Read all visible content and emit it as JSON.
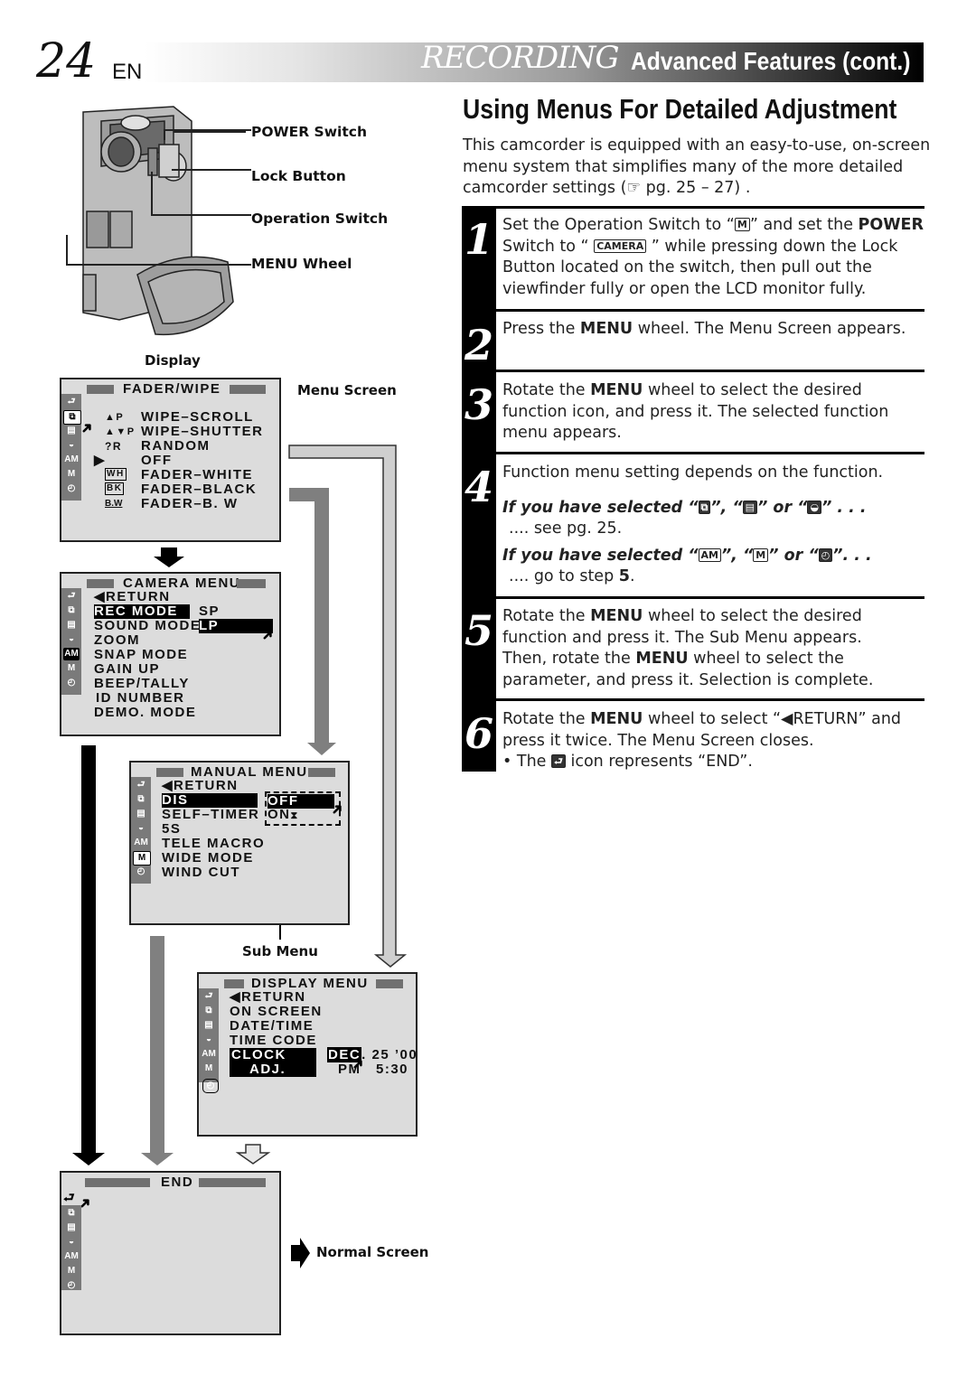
{
  "header": {
    "page_number": "24",
    "language": "EN",
    "section": "RECORDING",
    "subsection": "Advanced Features (cont.)"
  },
  "title": "Using Menus For Detailed Adjustment",
  "intro": "This camcorder is equipped with an easy-to-use, on-screen menu system that simplifies many of the more detailed camcorder settings (☞ pg. 25 – 27) .",
  "camera_callouts": {
    "power_switch": "POWER Switch",
    "lock_button": "Lock Button",
    "operation_switch": "Operation Switch",
    "menu_wheel": "MENU Wheel",
    "display": "Display"
  },
  "labels": {
    "menu_screen": "Menu Screen",
    "sub_menu": "Sub Menu",
    "normal_screen": "Normal Screen"
  },
  "steps": [
    {
      "number": "1",
      "parts": [
        "Set the Operation Switch to “",
        "M",
        "” and set the ",
        "POWER",
        " Switch to “ ",
        "CAMERA",
        " ” while pressing down the Lock Button located on the switch, then pull out the viewfinder fully or open the LCD monitor fully."
      ]
    },
    {
      "number": "2",
      "parts": [
        "Press the ",
        "MENU",
        " wheel. The Menu Screen appears."
      ]
    },
    {
      "number": "3",
      "parts": [
        "Rotate the ",
        "MENU",
        " wheel to select the desired function icon, and press it. The selected function menu appears."
      ]
    },
    {
      "number": "4",
      "text": "Function menu setting depends on the function.",
      "conditions": [
        {
          "lead": "If you have selected “",
          "icons": [
            "fader-wipe",
            "program-ae",
            "exposure"
          ],
          "tail": " . . .",
          "result": ".... see pg. 25."
        },
        {
          "lead": "If you have selected “",
          "icons": [
            "camera-menu",
            "manual-menu",
            "display-menu"
          ],
          "tail": ". . .",
          "result_pre": ".... go to step ",
          "result_bold": "5",
          "result_post": "."
        }
      ]
    },
    {
      "number": "5",
      "parts": [
        "Rotate the ",
        "MENU",
        " wheel to select the desired function and press it. The Sub Menu appears.",
        "Then, rotate the ",
        "MENU",
        " wheel to select the parameter, and press it. Selection is complete."
      ]
    },
    {
      "number": "6",
      "parts": [
        "Rotate the ",
        "MENU",
        " wheel to select “◀RETURN” and press it twice. The Menu Screen closes."
      ],
      "bullet": [
        "• The ",
        " icon represents “END”."
      ]
    }
  ],
  "screens": {
    "fader_wipe": {
      "title": "FADER/WIPE",
      "items": [
        {
          "icon": "▲P",
          "label": "WIPE–SCROLL"
        },
        {
          "icon": "▲▼P",
          "label": "WIPE–SHUTTER"
        },
        {
          "icon": "?R",
          "label": "RANDOM"
        },
        {
          "icon": "▶",
          "label": "OFF"
        },
        {
          "icon": "WH",
          "label": "FADER–WHITE"
        },
        {
          "icon": "BK",
          "label": "FADER–BLACK"
        },
        {
          "icon": "B.W",
          "label": "FADER–B. W"
        }
      ]
    },
    "camera_menu": {
      "title": "CAMERA MENU",
      "items": [
        "◀RETURN",
        "REC MODE",
        "SOUND MODE",
        "ZOOM",
        "SNAP MODE",
        "GAIN UP",
        "BEEP/TALLY",
        "ID NUMBER",
        "DEMO. MODE"
      ],
      "selected": "REC MODE",
      "options": [
        "SP",
        "LP"
      ],
      "selected_option": "LP"
    },
    "manual_menu": {
      "title": "MANUAL MENU",
      "items": [
        "◀RETURN",
        "DIS",
        "SELF–TIMER",
        "5S",
        "TELE MACRO",
        "WIDE MODE",
        "WIND CUT"
      ],
      "selected": "DIS",
      "options": [
        "OFF",
        "ON"
      ],
      "selected_option": "OFF"
    },
    "display_menu": {
      "title": "DISPLAY MENU",
      "items": [
        "◀RETURN",
        "ON SCREEN",
        "DATE/TIME",
        "TIME CODE",
        "CLOCK",
        "ADJ."
      ],
      "selected": "CLOCK ADJ.",
      "date_month": "DEC",
      "date_rest": ". 25 ’00",
      "time_ampm": "PM",
      "time": "5:30"
    },
    "end": {
      "title": "END"
    }
  },
  "side_icons": [
    "end-return",
    "fader-wipe",
    "program-ae",
    "exposure",
    "camera-menu",
    "manual-menu",
    "display-menu"
  ]
}
